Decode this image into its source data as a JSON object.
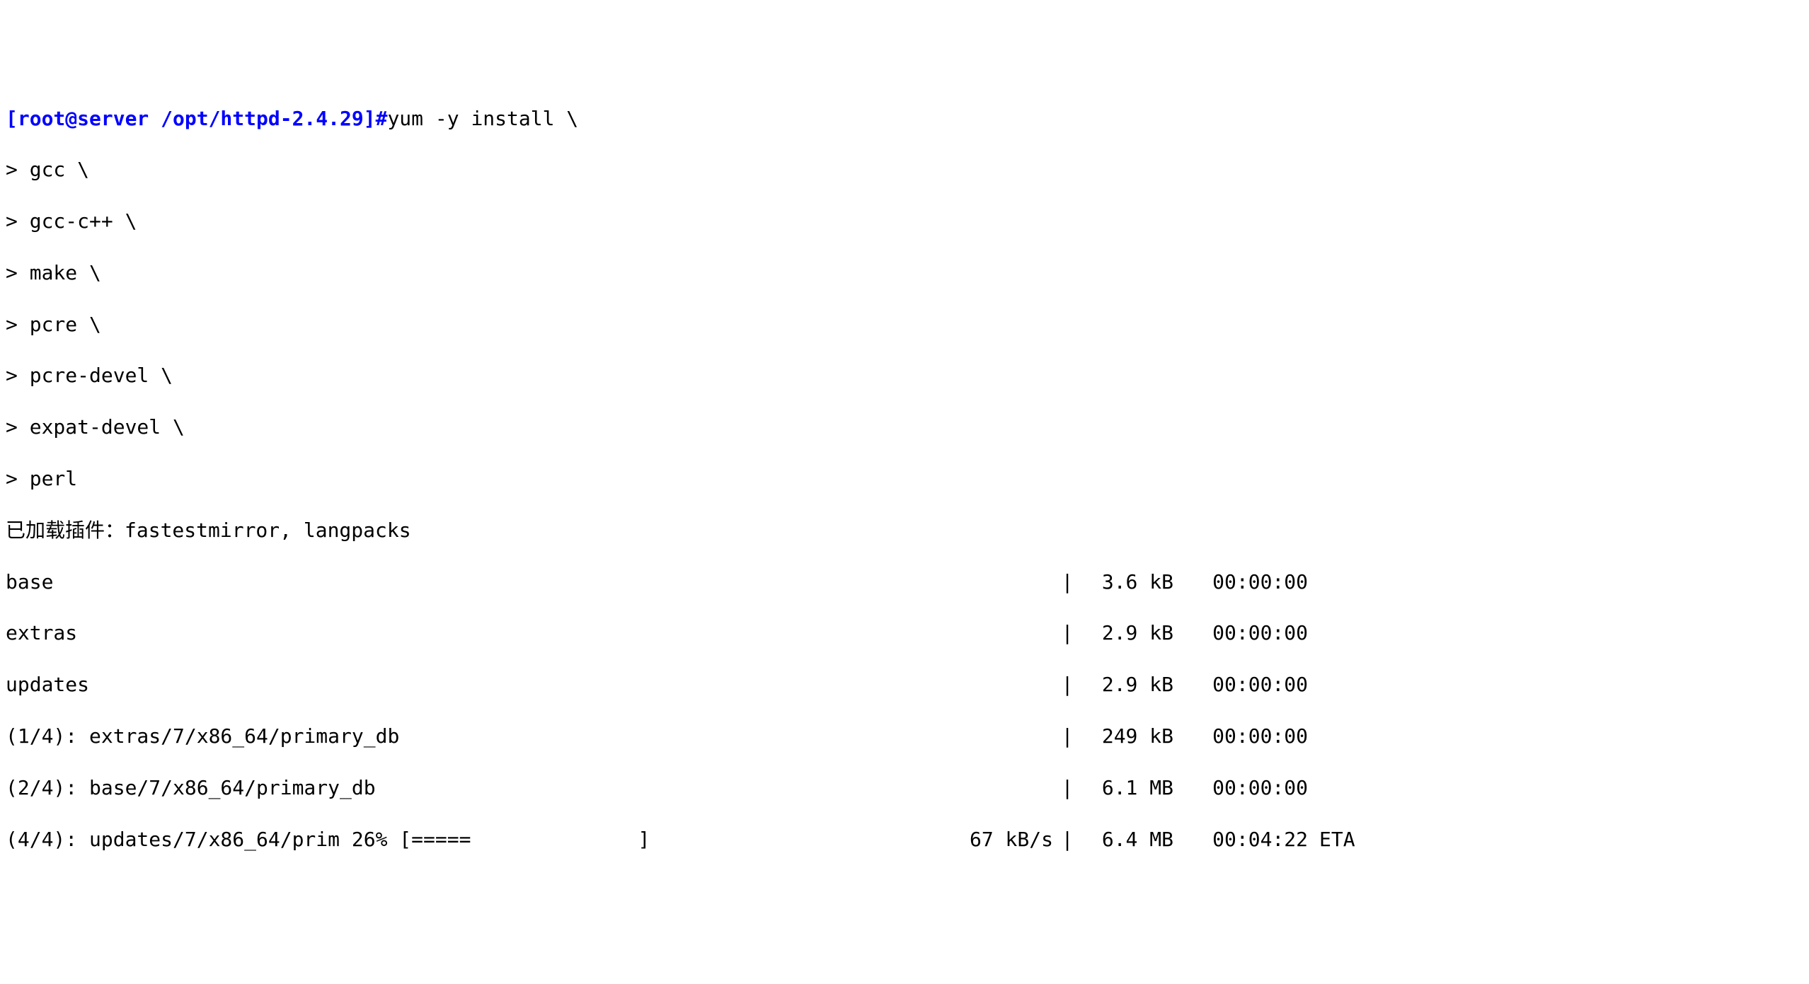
{
  "prompt": "[root@server /opt/httpd-2.4.29]#",
  "command": "yum -y install \\",
  "continuation_lines": [
    "> gcc \\",
    "> gcc-c++ \\",
    "> make \\",
    "> pcre \\",
    "> pcre-devel \\",
    "> expat-devel \\",
    "> perl"
  ],
  "plugins_line": "已加载插件：fastestmirror, langpacks",
  "repos": [
    {
      "name": "base",
      "speed": "",
      "pipe": "|",
      "size": "3.6 kB",
      "time": "00:00:00",
      "eta": ""
    },
    {
      "name": "extras",
      "speed": "",
      "pipe": "|",
      "size": "2.9 kB",
      "time": "00:00:00",
      "eta": ""
    },
    {
      "name": "updates",
      "speed": "",
      "pipe": "|",
      "size": "2.9 kB",
      "time": "00:00:00",
      "eta": ""
    },
    {
      "name": "(1/4): extras/7/x86_64/primary_db",
      "speed": "",
      "pipe": "|",
      "size": "249 kB",
      "time": "00:00:00",
      "eta": ""
    },
    {
      "name": "(2/4): base/7/x86_64/primary_db",
      "speed": "",
      "pipe": "|",
      "size": "6.1 MB",
      "time": "00:00:00",
      "eta": ""
    },
    {
      "name": "(4/4): updates/7/x86_64/prim 26% [=====              ]",
      "speed": "67 kB/s",
      "pipe": "|",
      "size": "6.4 MB",
      "time": "00:04:22",
      "eta": "ETA"
    }
  ]
}
